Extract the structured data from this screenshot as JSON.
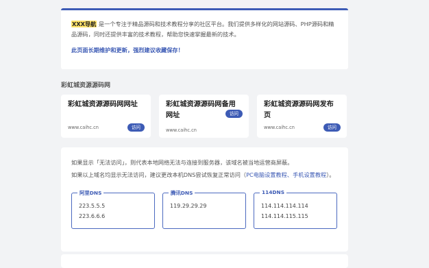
{
  "intro": {
    "brand": "XXX导航",
    "text": " 是一个专注于精品源码和技术教程分享的社区平台。我们提供多样化的网站源码、PHP源码和精品源码，同时还提供丰富的技术教程，帮助您快速掌握最新的技术。",
    "notice": "此页面长期维护和更新，强烈建议收藏保存！"
  },
  "section_title": "彩虹城资源源码网",
  "links": [
    {
      "name": "彩虹城资源源码网网址",
      "url": "www.caihc.cn",
      "button": "访问"
    },
    {
      "name": "彩虹城资源源码网备用网址",
      "url": "www.caihc.cn",
      "button": "访问"
    },
    {
      "name": "彩虹城资源源码网发布页",
      "url": "www.caihc.cn",
      "button": "访问"
    }
  ],
  "info": {
    "line1": "如果显示「无法访问」，则代表本地网络无法与连接到服务器，该域名被当地运营商屏蔽。",
    "line2_prefix": "如果以上域名均显示无法访问，建议更改本机DNS尝试恢复正常访问（",
    "line2_link1": "PC电脑设置教程",
    "line2_sep": "、",
    "line2_link2": "手机设置教程",
    "line2_suffix": "）。"
  },
  "dns": [
    {
      "name": "阿里DNS",
      "ips": [
        "223.5.5.5",
        "223.6.6.6"
      ]
    },
    {
      "name": "腾讯DNS",
      "ips": [
        "119.29.29.29"
      ]
    },
    {
      "name": "114DNS",
      "ips": [
        "114.114.114.114",
        "114.114.115.115"
      ]
    }
  ],
  "colors": {
    "accent": "#3d5bb5",
    "brand_highlight": "#ffe36a",
    "background": "#f2f3f5"
  }
}
